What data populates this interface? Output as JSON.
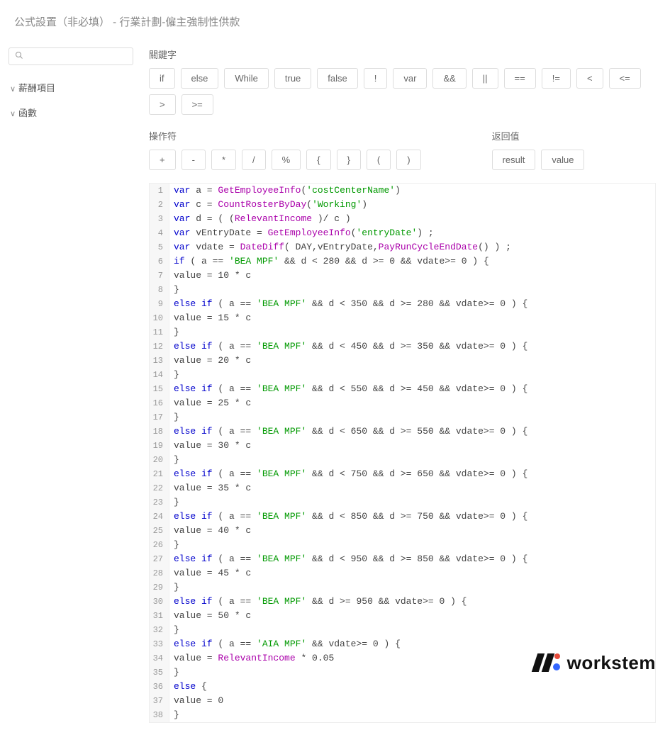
{
  "header": {
    "title": "公式設置（非必填） - 行業計劃-僱主強制性供款"
  },
  "sidebar": {
    "search_placeholder": "",
    "items": [
      {
        "label": "薪酬項目"
      },
      {
        "label": "函數"
      }
    ]
  },
  "sections": {
    "keywords_label": "關鍵字",
    "operators_label": "操作符",
    "return_label": "返回值"
  },
  "keyword_buttons": [
    "if",
    "else",
    "While",
    "true",
    "false",
    "!",
    "var",
    "&&",
    "||",
    "==",
    "!=",
    "<",
    "<=",
    ">",
    ">="
  ],
  "operator_buttons": [
    "+",
    "-",
    "*",
    "/",
    "%",
    "{",
    "}",
    "(",
    ")"
  ],
  "return_buttons": [
    "result",
    "value"
  ],
  "code": [
    {
      "n": 1,
      "t": [
        [
          "kw",
          "var"
        ],
        [
          "var",
          " a = "
        ],
        [
          "fn",
          "GetEmployeeInfo"
        ],
        [
          "var",
          "("
        ],
        [
          "str",
          "'costCenterName'"
        ],
        [
          "var",
          ")"
        ]
      ]
    },
    {
      "n": 2,
      "t": [
        [
          "kw",
          "var"
        ],
        [
          "var",
          " c = "
        ],
        [
          "fn",
          "CountRosterByDay"
        ],
        [
          "var",
          "("
        ],
        [
          "str",
          "'Working'"
        ],
        [
          "var",
          ")"
        ]
      ]
    },
    {
      "n": 3,
      "t": [
        [
          "kw",
          "var"
        ],
        [
          "var",
          " d = ( ("
        ],
        [
          "fn",
          "RelevantIncome"
        ],
        [
          "var",
          " )/ c )"
        ]
      ]
    },
    {
      "n": 4,
      "t": [
        [
          "kw",
          "var"
        ],
        [
          "var",
          " vEntryDate = "
        ],
        [
          "fn",
          "GetEmployeeInfo"
        ],
        [
          "var",
          "("
        ],
        [
          "str",
          "'entryDate'"
        ],
        [
          "var",
          ") ;"
        ]
      ]
    },
    {
      "n": 5,
      "t": [
        [
          "kw",
          "var"
        ],
        [
          "var",
          " vdate = "
        ],
        [
          "fn",
          "DateDiff"
        ],
        [
          "var",
          "( DAY,vEntryDate,"
        ],
        [
          "fn",
          "PayRunCycleEndDate"
        ],
        [
          "var",
          "() ) ;"
        ]
      ]
    },
    {
      "n": 6,
      "t": [
        [
          "kw",
          "if"
        ],
        [
          "var",
          " ( a == "
        ],
        [
          "str",
          "'BEA MPF'"
        ],
        [
          "var",
          " && d < 280 && d >= 0 && vdate>= 0 ) {"
        ]
      ]
    },
    {
      "n": 7,
      "t": [
        [
          "var",
          "value = 10 * c"
        ]
      ]
    },
    {
      "n": 8,
      "t": [
        [
          "var",
          "}"
        ]
      ]
    },
    {
      "n": 9,
      "t": [
        [
          "kw",
          "else if"
        ],
        [
          "var",
          " ( a == "
        ],
        [
          "str",
          "'BEA MPF'"
        ],
        [
          "var",
          " && d < 350 && d >= 280 && vdate>= 0 ) {"
        ]
      ]
    },
    {
      "n": 10,
      "t": [
        [
          "var",
          "value = 15 * c"
        ]
      ]
    },
    {
      "n": 11,
      "t": [
        [
          "var",
          "}"
        ]
      ]
    },
    {
      "n": 12,
      "t": [
        [
          "kw",
          "else if"
        ],
        [
          "var",
          " ( a == "
        ],
        [
          "str",
          "'BEA MPF'"
        ],
        [
          "var",
          " && d < 450 && d >= 350 && vdate>= 0 ) {"
        ]
      ]
    },
    {
      "n": 13,
      "t": [
        [
          "var",
          "value = 20 * c"
        ]
      ]
    },
    {
      "n": 14,
      "t": [
        [
          "var",
          "}"
        ]
      ]
    },
    {
      "n": 15,
      "t": [
        [
          "kw",
          "else if"
        ],
        [
          "var",
          " ( a == "
        ],
        [
          "str",
          "'BEA MPF'"
        ],
        [
          "var",
          " && d < 550 && d >= 450 && vdate>= 0 ) {"
        ]
      ]
    },
    {
      "n": 16,
      "t": [
        [
          "var",
          "value = 25 * c"
        ]
      ]
    },
    {
      "n": 17,
      "t": [
        [
          "var",
          "}"
        ]
      ]
    },
    {
      "n": 18,
      "t": [
        [
          "kw",
          "else if"
        ],
        [
          "var",
          " ( a == "
        ],
        [
          "str",
          "'BEA MPF'"
        ],
        [
          "var",
          " && d < 650 && d >= 550 && vdate>= 0 ) {"
        ]
      ]
    },
    {
      "n": 19,
      "t": [
        [
          "var",
          "value = 30 * c"
        ]
      ]
    },
    {
      "n": 20,
      "t": [
        [
          "var",
          "}"
        ]
      ]
    },
    {
      "n": 21,
      "t": [
        [
          "kw",
          "else if"
        ],
        [
          "var",
          " ( a == "
        ],
        [
          "str",
          "'BEA MPF'"
        ],
        [
          "var",
          " && d < 750 && d >= 650 && vdate>= 0 ) {"
        ]
      ]
    },
    {
      "n": 22,
      "t": [
        [
          "var",
          "value = 35 * c"
        ]
      ]
    },
    {
      "n": 23,
      "t": [
        [
          "var",
          "}"
        ]
      ]
    },
    {
      "n": 24,
      "t": [
        [
          "kw",
          "else if"
        ],
        [
          "var",
          " ( a == "
        ],
        [
          "str",
          "'BEA MPF'"
        ],
        [
          "var",
          " && d < 850 && d >= 750 && vdate>= 0 ) {"
        ]
      ]
    },
    {
      "n": 25,
      "t": [
        [
          "var",
          "value = 40 * c"
        ]
      ]
    },
    {
      "n": 26,
      "t": [
        [
          "var",
          "}"
        ]
      ]
    },
    {
      "n": 27,
      "t": [
        [
          "kw",
          "else if"
        ],
        [
          "var",
          " ( a == "
        ],
        [
          "str",
          "'BEA MPF'"
        ],
        [
          "var",
          " && d < 950 && d >= 850 && vdate>= 0 ) {"
        ]
      ]
    },
    {
      "n": 28,
      "t": [
        [
          "var",
          "value = 45 * c"
        ]
      ]
    },
    {
      "n": 29,
      "t": [
        [
          "var",
          "}"
        ]
      ]
    },
    {
      "n": 30,
      "t": [
        [
          "kw",
          "else if"
        ],
        [
          "var",
          " ( a == "
        ],
        [
          "str",
          "'BEA MPF'"
        ],
        [
          "var",
          " && d >= 950 && vdate>= 0 ) {"
        ]
      ]
    },
    {
      "n": 31,
      "t": [
        [
          "var",
          "value = 50 * c"
        ]
      ]
    },
    {
      "n": 32,
      "t": [
        [
          "var",
          "}"
        ]
      ]
    },
    {
      "n": 33,
      "t": [
        [
          "kw",
          "else if"
        ],
        [
          "var",
          " ( a == "
        ],
        [
          "str",
          "'AIA MPF'"
        ],
        [
          "var",
          " && vdate>= 0 ) {"
        ]
      ]
    },
    {
      "n": 34,
      "t": [
        [
          "var",
          "value = "
        ],
        [
          "fn",
          "RelevantIncome"
        ],
        [
          "var",
          " * 0.05"
        ]
      ]
    },
    {
      "n": 35,
      "t": [
        [
          "var",
          "}"
        ]
      ]
    },
    {
      "n": 36,
      "t": [
        [
          "kw",
          "else"
        ],
        [
          "var",
          " {"
        ]
      ]
    },
    {
      "n": 37,
      "t": [
        [
          "var",
          "value = 0"
        ]
      ]
    },
    {
      "n": 38,
      "t": [
        [
          "var",
          "}"
        ]
      ]
    }
  ],
  "logo": {
    "text": "workstem"
  }
}
